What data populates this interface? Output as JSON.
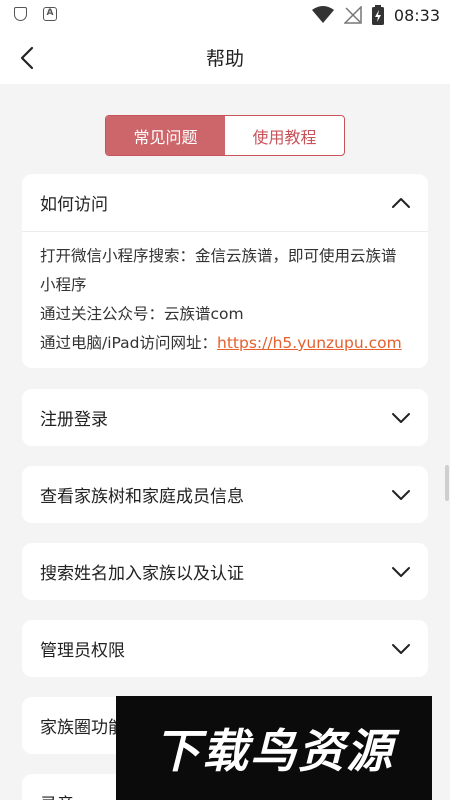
{
  "status_bar": {
    "time": "08:33",
    "left_icons": [
      "shield-icon",
      "a-badge-icon"
    ],
    "right_icons": [
      "wifi-icon",
      "no-signal-icon",
      "battery-icon"
    ],
    "a_badge": "A"
  },
  "header": {
    "title": "帮助"
  },
  "tabs": [
    {
      "label": "常见问题",
      "active": true
    },
    {
      "label": "使用教程",
      "active": false
    }
  ],
  "faq": [
    {
      "title": "如何访问",
      "expanded": true,
      "lines": [
        "打开微信小程序搜索：金信云族谱，即可使用云族谱小程序",
        "通过关注公众号：云族谱com"
      ],
      "web_prefix": "通过电脑/iPad访问网址：",
      "web_link": "https://h5.yunzupu.com"
    },
    {
      "title": "注册登录",
      "expanded": false
    },
    {
      "title": "查看家族树和家庭成员信息",
      "expanded": false
    },
    {
      "title": "搜索姓名加入家族以及认证",
      "expanded": false
    },
    {
      "title": "管理员权限",
      "expanded": false
    },
    {
      "title": "家族圈功能",
      "expanded": false
    },
    {
      "title": "录音",
      "expanded": false
    }
  ],
  "watermark": {
    "text": "下载鸟资源"
  },
  "colors": {
    "accent": "#cd666b",
    "link": "#e5602c",
    "background": "#f4f4f4"
  }
}
